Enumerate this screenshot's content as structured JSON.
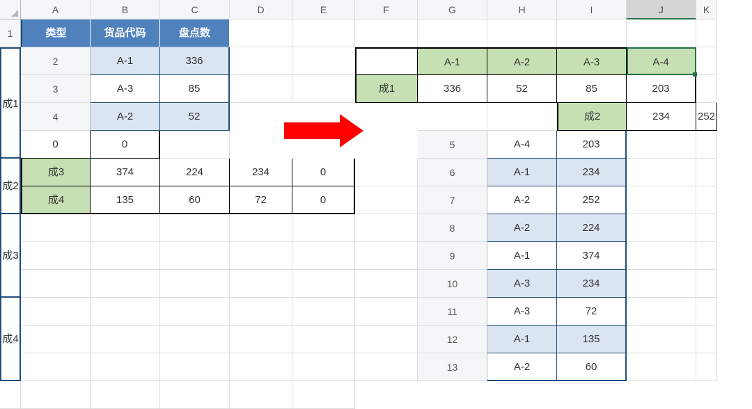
{
  "columns": [
    "A",
    "B",
    "C",
    "D",
    "E",
    "F",
    "G",
    "H",
    "I",
    "J",
    "K"
  ],
  "rows": [
    "1",
    "2",
    "3",
    "4",
    "5",
    "6",
    "7",
    "8",
    "9",
    "10",
    "11",
    "12",
    "13"
  ],
  "selected_col": "J",
  "left_table": {
    "headers": [
      "类型",
      "货品代码",
      "盘点数"
    ],
    "groups": [
      {
        "type": "成1",
        "rows": [
          {
            "code": "A-1",
            "count": "336",
            "stripe": true
          },
          {
            "code": "A-3",
            "count": "85",
            "stripe": false
          },
          {
            "code": "A-2",
            "count": "52",
            "stripe": true
          },
          {
            "code": "A-4",
            "count": "203",
            "stripe": false
          }
        ]
      },
      {
        "type": "成2",
        "rows": [
          {
            "code": "A-1",
            "count": "234",
            "stripe": true
          },
          {
            "code": "A-2",
            "count": "252",
            "stripe": false
          }
        ]
      },
      {
        "type": "成3",
        "rows": [
          {
            "code": "A-2",
            "count": "224",
            "stripe": true
          },
          {
            "code": "A-1",
            "count": "374",
            "stripe": false
          },
          {
            "code": "A-3",
            "count": "234",
            "stripe": true
          }
        ]
      },
      {
        "type": "成4",
        "rows": [
          {
            "code": "A-3",
            "count": "72",
            "stripe": false
          },
          {
            "code": "A-1",
            "count": "135",
            "stripe": true
          },
          {
            "code": "A-2",
            "count": "60",
            "stripe": false
          }
        ]
      }
    ]
  },
  "right_table": {
    "col_headers": [
      "A-1",
      "A-2",
      "A-3",
      "A-4"
    ],
    "rows": [
      {
        "label": "成1",
        "values": [
          "336",
          "52",
          "85",
          "203"
        ]
      },
      {
        "label": "成2",
        "values": [
          "234",
          "252",
          "0",
          "0"
        ]
      },
      {
        "label": "成3",
        "values": [
          "374",
          "224",
          "234",
          "0"
        ]
      },
      {
        "label": "成4",
        "values": [
          "135",
          "60",
          "72",
          "0"
        ]
      }
    ]
  }
}
